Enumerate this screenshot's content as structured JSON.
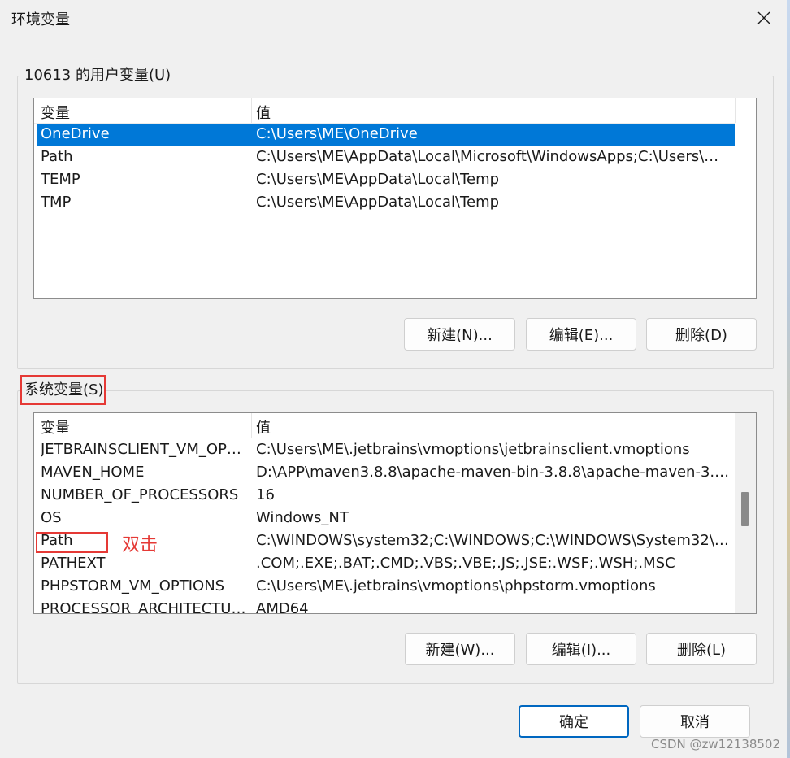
{
  "window": {
    "title": "环境变量",
    "close_icon": "close-icon"
  },
  "user_vars": {
    "legend": "10613 的用户变量(U)",
    "col_name": "变量",
    "col_value": "值",
    "rows": [
      {
        "name": "OneDrive",
        "value": "C:\\Users\\ME\\OneDrive",
        "selected": true
      },
      {
        "name": "Path",
        "value": "C:\\Users\\ME\\AppData\\Local\\Microsoft\\WindowsApps;C:\\Users\\ME..."
      },
      {
        "name": "TEMP",
        "value": "C:\\Users\\ME\\AppData\\Local\\Temp"
      },
      {
        "name": "TMP",
        "value": "C:\\Users\\ME\\AppData\\Local\\Temp"
      }
    ],
    "buttons": {
      "new": "新建(N)...",
      "edit": "编辑(E)...",
      "delete": "删除(D)"
    }
  },
  "system_vars": {
    "legend": "系统变量(S)",
    "col_name": "变量",
    "col_value": "值",
    "rows": [
      {
        "name": "JETBRAINSCLIENT_VM_OPTI...",
        "value": "C:\\Users\\ME\\.jetbrains\\vmoptions\\jetbrainsclient.vmoptions"
      },
      {
        "name": "MAVEN_HOME",
        "value": "D:\\APP\\maven3.8.8\\apache-maven-bin-3.8.8\\apache-maven-3.8.8"
      },
      {
        "name": "NUMBER_OF_PROCESSORS",
        "value": "16"
      },
      {
        "name": "OS",
        "value": "Windows_NT"
      },
      {
        "name": "Path",
        "value": "C:\\WINDOWS\\system32;C:\\WINDOWS;C:\\WINDOWS\\System32\\W..."
      },
      {
        "name": "PATHEXT",
        "value": ".COM;.EXE;.BAT;.CMD;.VBS;.VBE;.JS;.JSE;.WSF;.WSH;.MSC"
      },
      {
        "name": "PHPSTORM_VM_OPTIONS",
        "value": "C:\\Users\\ME\\.jetbrains\\vmoptions\\phpstorm.vmoptions"
      },
      {
        "name": "PROCESSOR_ARCHITECTURE",
        "value": "AMD64"
      }
    ],
    "buttons": {
      "new": "新建(W)...",
      "edit": "编辑(I)...",
      "delete": "删除(L)"
    }
  },
  "annotation": {
    "text": "双击"
  },
  "footer": {
    "ok": "确定",
    "cancel": "取消"
  },
  "watermark": "CSDN @zw12138502",
  "colors": {
    "selection": "#0078d7",
    "annotation": "#e53935",
    "primary_border": "#0067c0"
  }
}
